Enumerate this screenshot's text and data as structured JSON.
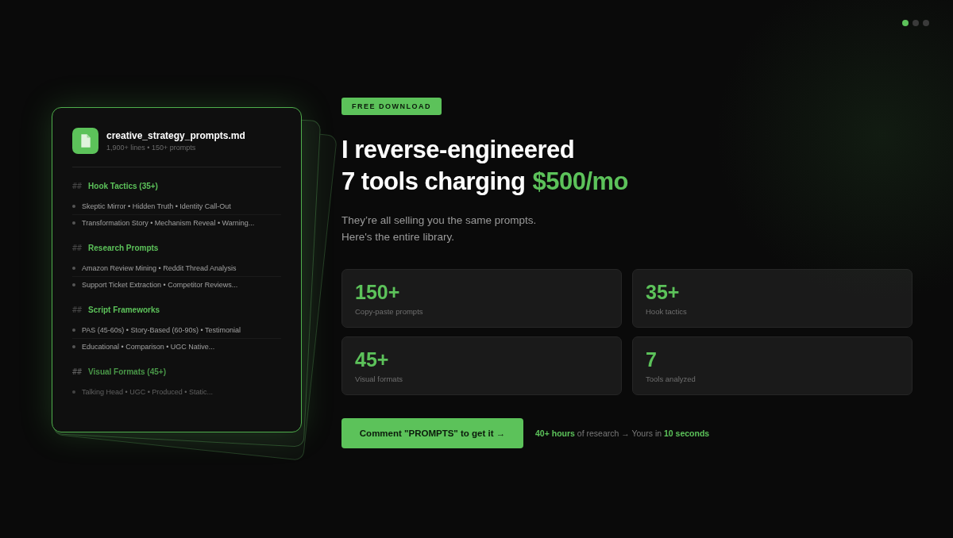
{
  "page_dots": [
    {
      "selected": true
    },
    {
      "selected": false
    },
    {
      "selected": false
    }
  ],
  "file_card": {
    "filename": "creative_strategy_prompts.md",
    "meta": "1,900+ lines • 150+ prompts",
    "sections": [
      {
        "marker": "##",
        "title": "Hook Tactics (35+)",
        "faded": false,
        "items": [
          "Skeptic Mirror • Hidden Truth • Identity Call-Out",
          "Transformation Story • Mechanism Reveal • Warning..."
        ]
      },
      {
        "marker": "##",
        "title": "Research Prompts",
        "faded": false,
        "items": [
          "Amazon Review Mining • Reddit Thread Analysis",
          "Support Ticket Extraction • Competitor Reviews..."
        ]
      },
      {
        "marker": "##",
        "title": "Script Frameworks",
        "faded": false,
        "items": [
          "PAS (45-60s) • Story-Based (60-90s) • Testimonial",
          "Educational • Comparison • UGC Native..."
        ]
      },
      {
        "marker": "##",
        "title": "Visual Formats (45+)",
        "faded": true,
        "items": [
          "Talking Head • UGC • Produced • Static..."
        ]
      }
    ]
  },
  "badge": "FREE DOWNLOAD",
  "headline": {
    "line_1": "I reverse-engineered",
    "line_2": "7 tools charging",
    "accent": "$500/mo"
  },
  "subtitle": [
    "They’re all selling you the same prompts.",
    "Here's the entire library."
  ],
  "stats": [
    {
      "value": "150+",
      "label": "Copy-paste prompts"
    },
    {
      "value": "35+",
      "label": "Hook tactics"
    },
    {
      "value": "45+",
      "label": "Visual formats"
    },
    {
      "value": "7",
      "label": "Tools analyzed"
    }
  ],
  "cta": {
    "button": "Comment \"PROMPTS\" to get it →",
    "note": "**40+ hours** of research → Yours in **10 seconds**"
  }
}
